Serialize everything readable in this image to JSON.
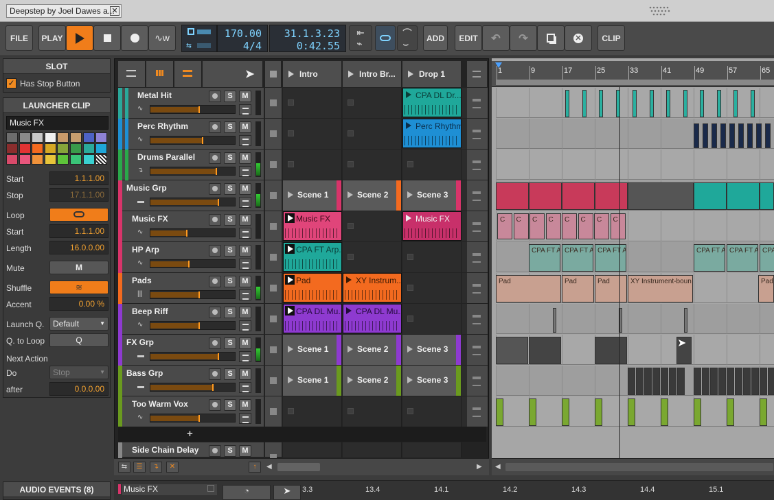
{
  "window": {
    "tab_title": "Deepstep by Joel Dawes a...",
    "close": "✕"
  },
  "toolbar": {
    "file": "FILE",
    "play": "PLAY",
    "tempo": "170.00",
    "signature": "4/4",
    "position_bars": "31.1.3.23",
    "position_time": "0:42.55",
    "add": "ADD",
    "edit": "EDIT",
    "clip": "CLIP"
  },
  "slot_panel": {
    "header": "SLOT",
    "has_stop_button": "Has Stop Button"
  },
  "launcher_clip": {
    "header": "LAUNCHER CLIP",
    "clip_name": "Music FX",
    "colors": [
      "#6d6d6d",
      "#8a8a8a",
      "#c8c8c8",
      "#f0f0f0",
      "#c89a6a",
      "#c89e6e",
      "#4d62c4",
      "#8f83d6",
      "#8a2d2d",
      "#e03333",
      "#f36a1f",
      "#d6a824",
      "#87a43a",
      "#3a9a4a",
      "#2aaa9a",
      "#1fa6d8",
      "#d84a6a",
      "#e8567c",
      "#f0923a",
      "#e8c43a",
      "#5ec43a",
      "#3ac478",
      "#3ad0d0",
      "#67c0f0"
    ],
    "start_label": "Start",
    "start": "1.1.1.00",
    "stop_label": "Stop",
    "stop": "17.1.1.00",
    "loop_label": "Loop",
    "loop_start_label": "Start",
    "loop_start": "1.1.1.00",
    "length_label": "Length",
    "length": "16.0.0.00",
    "mute_label": "Mute",
    "mute_btn": "M",
    "shuffle_label": "Shuffle",
    "accent_label": "Accent",
    "accent": "0.00 %",
    "launch_q_label": "Launch Q.",
    "launch_q": "Default",
    "q_to_loop_label": "Q. to Loop",
    "q_to_loop": "Q",
    "next_action_label": "Next Action",
    "do_label": "Do",
    "do_value": "Stop",
    "after_label": "after",
    "after": "0.0.0.00"
  },
  "audio_events": {
    "header": "AUDIO EVENTS (8)"
  },
  "scenes": [
    "Intro",
    "Intro Br...",
    "Drop 1"
  ],
  "tracks": [
    {
      "name": "Metal Hit",
      "color": "#2aa89a"
    },
    {
      "name": "Perc Rhythm",
      "color": "#1e8fd4"
    },
    {
      "name": "Drums Parallel",
      "color": "#2aa84a"
    },
    {
      "name": "Music Grp",
      "color": "#d8346a"
    },
    {
      "name": "Music FX",
      "color": "#d8346a"
    },
    {
      "name": "HP Arp",
      "color": "#d8346a"
    },
    {
      "name": "Pads",
      "color": "#f36a1f"
    },
    {
      "name": "Beep Riff",
      "color": "#8e3ad0"
    },
    {
      "name": "FX Grp",
      "color": "#8e3ad0"
    },
    {
      "name": "Bass Grp",
      "color": "#6a9a1e"
    },
    {
      "name": "Too Warm Vox",
      "color": "#6a9a1e"
    },
    {
      "name": "Side Chain Delay",
      "color": "#888888"
    }
  ],
  "clips": {
    "metal_drop": "CPA DL Dr...",
    "perc_drop": "Perc Rhythm",
    "scene1": "Scene 1",
    "scene2": "Scene 2",
    "scene3": "Scene 3",
    "musicfx_intro": "Music FX",
    "musicfx_drop": "Music FX",
    "hparp_intro": "CPA FT Arp...",
    "pads_intro": "Pad",
    "pads_break": "XY Instrum...",
    "beep_intro": "CPA DL Mu...",
    "beep_break": "CPA DL Mu..."
  },
  "ruler": [
    "1",
    "9",
    "17",
    "25",
    "33",
    "41",
    "49",
    "57",
    "65"
  ],
  "arranger_labels": {
    "c": "C",
    "cpa": "CPA FT A",
    "pad": "Pad",
    "xy": "XY Instrument-boun"
  },
  "bottom": {
    "track": "Music FX",
    "ticks": [
      "3.3",
      "13.4",
      "14.1",
      "14.2",
      "14.3",
      "14.4",
      "15.1"
    ]
  },
  "add_icon": "+"
}
